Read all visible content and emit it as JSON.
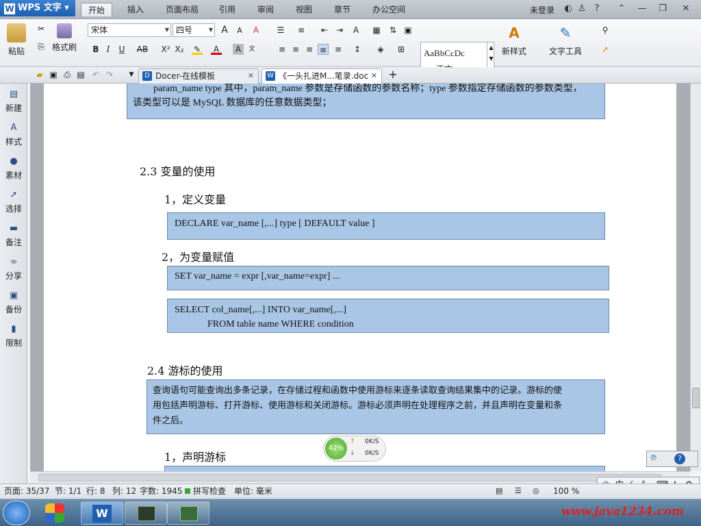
{
  "app": {
    "logo": "WPS 文字",
    "logo_letter": "W",
    "login": "未登录"
  },
  "menu_tabs": [
    "开始",
    "插入",
    "页面布局",
    "引用",
    "审阅",
    "视图",
    "章节",
    "办公空间"
  ],
  "ribbon": {
    "paste": "粘贴",
    "format_painter": "格式刷",
    "font_name": "宋体",
    "font_size": "四号",
    "style_preview": "AaBbCcDc",
    "style_name": "正文",
    "new_style": "新样式",
    "text_tools": "文字工具"
  },
  "doc_tabs": [
    {
      "label": "Docer-在线模板",
      "close": "✕"
    },
    {
      "label": "《一头扎进M...笔录.doc",
      "close": "✕"
    }
  ],
  "sidebar": [
    "新建",
    "样式",
    "素材",
    "选择",
    "备注",
    "分享",
    "备份",
    "限制"
  ],
  "document": {
    "box0_line1": "param_name type      其中，param_name 参数是存储函数的参数名称；type 参数指定存储函数的参数类型，",
    "box0_line2": "该类型可以是 MySQL 数据库的任意数据类型；",
    "h_2_3": "2.3  变量的使用",
    "h_define": "1，定义变量",
    "code_declare": "DECLARE var_name [,...]    type [ DEFAULT value ]",
    "h_assign": "2，为变量赋值",
    "code_set": "SET var_name = expr [,var_name=expr] ...",
    "code_select_1": "SELECT col_name[,...] INTO var_name[,...]",
    "code_select_2": "FROM table  name WHERE condition",
    "h_2_4": "2.4  游标的使用",
    "cursor_p1": "查询语句可能查询出多条记录，在存储过程和函数中使用游标来逐条读取查询结果集中的记录。游标的使",
    "cursor_p2": "用包括声明游标、打开游标、使用游标和关闭游标。游标必须声明在处理程序之前，并且声明在变量和条",
    "cursor_p3": "件之后。",
    "h_declare_cursor": "1，声明游标"
  },
  "status": {
    "page": "页面: 35/37",
    "section": "节: 1/1",
    "row": "行: 8",
    "col": "列: 12",
    "words": "字数: 1945",
    "spell": "拼写检查",
    "unit": "单位: 毫米",
    "zoom": "100 %"
  },
  "net_widget": {
    "percent": "42%",
    "up": "0K/S",
    "down": "0K/S"
  },
  "ime": {
    "label": "中"
  },
  "watermark": "www.java1234.com",
  "colors": {
    "box_fill": "#a9c6e6",
    "box_border": "#6a88a8",
    "accent": "#1f5fb0"
  }
}
